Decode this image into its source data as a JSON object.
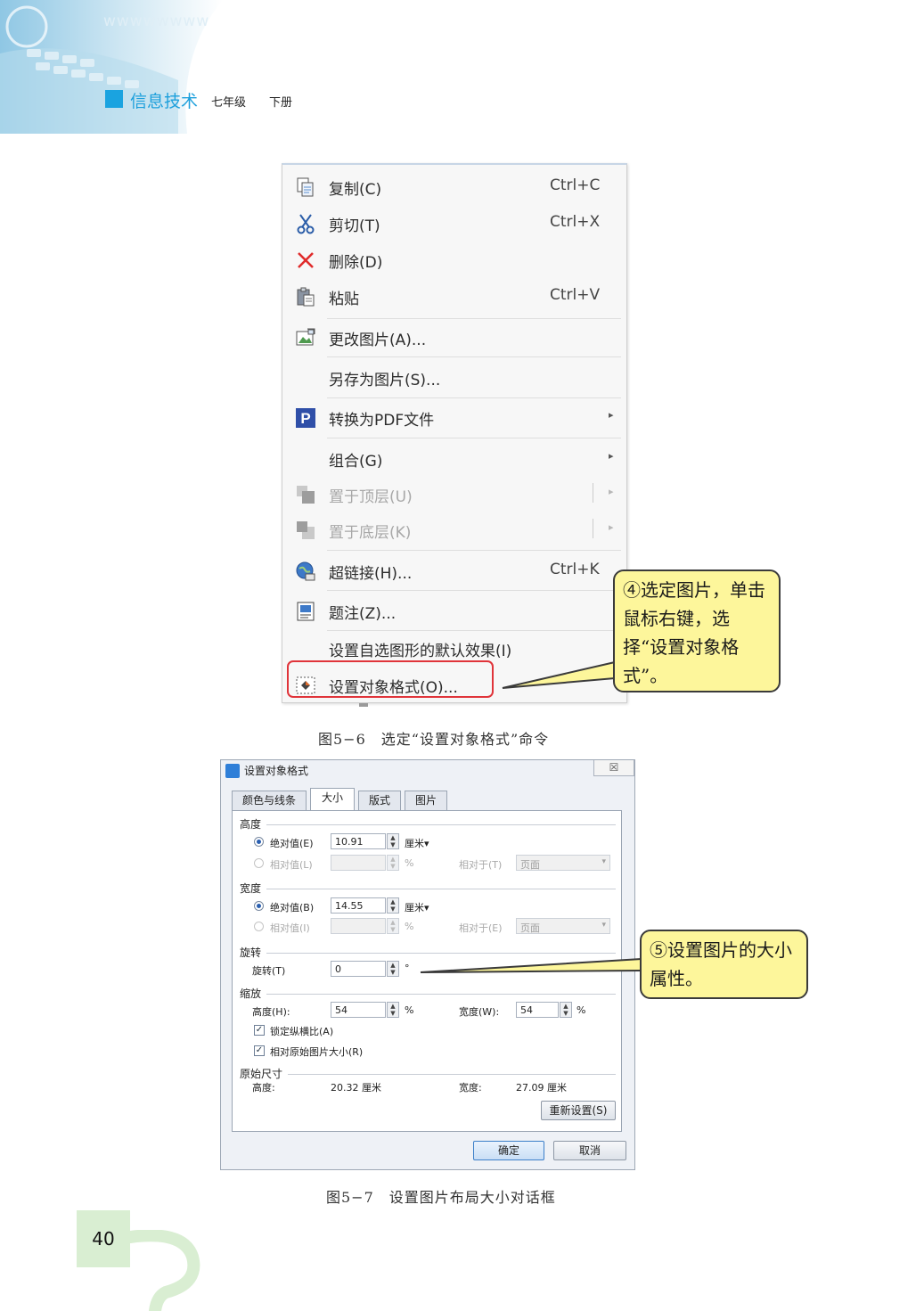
{
  "header": {
    "subject": "信息技术",
    "grade": "七年级",
    "volume": "下册",
    "banner_text": "wwwwwwww"
  },
  "menu": {
    "items": [
      {
        "label": "复制(C)",
        "shortcut": "Ctrl+C",
        "icon": "copy-icon"
      },
      {
        "label": "剪切(T)",
        "shortcut": "Ctrl+X",
        "icon": "scissors-icon"
      },
      {
        "label": "删除(D)",
        "shortcut": "",
        "icon": "delete-x-icon"
      },
      {
        "label": "粘贴",
        "shortcut": "Ctrl+V",
        "icon": "paste-icon"
      },
      {
        "label": "更改图片(A)...",
        "shortcut": "",
        "icon": "change-picture-icon"
      },
      {
        "label": "另存为图片(S)...",
        "shortcut": "",
        "icon": ""
      },
      {
        "label": "转换为PDF文件",
        "shortcut": "",
        "icon": "pdf-p-icon",
        "submenu": true
      },
      {
        "label": "组合(G)",
        "shortcut": "",
        "icon": "",
        "submenu": true
      },
      {
        "label": "置于顶层(U)",
        "shortcut": "",
        "icon": "bring-to-front-icon",
        "submenu": true,
        "disabled": true
      },
      {
        "label": "置于底层(K)",
        "shortcut": "",
        "icon": "send-to-back-icon",
        "submenu": true,
        "disabled": true
      },
      {
        "label": "超链接(H)...",
        "shortcut": "Ctrl+K",
        "icon": "hyperlink-globe-icon"
      },
      {
        "label": "题注(Z)...",
        "shortcut": "",
        "icon": "caption-icon"
      },
      {
        "label": "设置自选图形的默认效果(I)",
        "shortcut": "",
        "icon": ""
      },
      {
        "label": "设置对象格式(O)...",
        "shortcut": "",
        "icon": "format-object-icon",
        "highlighted": true
      }
    ]
  },
  "callout1": "④选定图片，单击鼠标右键，选择“设置对象格式”。",
  "caption1": "图5−6　选定“设置对象格式”命令",
  "dialog": {
    "title": "设置对象格式",
    "close": "☒",
    "tabs": [
      "颜色与线条",
      "大小",
      "版式",
      "图片"
    ],
    "height_group": "高度",
    "width_group": "宽度",
    "rotate_group": "旋转",
    "scale_group": "缩放",
    "original_group": "原始尺寸",
    "absolute_h": "绝对值(E)",
    "absolute_h_value": "10.91",
    "relative_h": "相对值(L)",
    "relative_to_t": "相对于(T)",
    "absolute_w": "绝对值(B)",
    "absolute_w_value": "14.55",
    "relative_w": "相对值(I)",
    "relative_to_e": "相对于(E)",
    "unit_cm": "厘米▾",
    "percent": "%",
    "page_option": "页面",
    "rotate_label": "旋转(T)",
    "rotate_value": "0",
    "degree": "°",
    "scale_h_label": "高度(H):",
    "scale_h_value": "54",
    "scale_w_label": "宽度(W):",
    "scale_w_value": "54",
    "lock_ratio": "锁定纵横比(A)",
    "relative_original": "相对原始图片大小(R)",
    "orig_h_label": "高度:",
    "orig_h_value": "20.32 厘米",
    "orig_w_label": "宽度:",
    "orig_w_value": "27.09 厘米",
    "reset": "重新设置(S)",
    "ok": "确定",
    "cancel": "取消"
  },
  "callout2": "⑤设置图片的大小属性。",
  "caption2": "图5−7　设置图片布局大小对话框",
  "page_number": "40"
}
